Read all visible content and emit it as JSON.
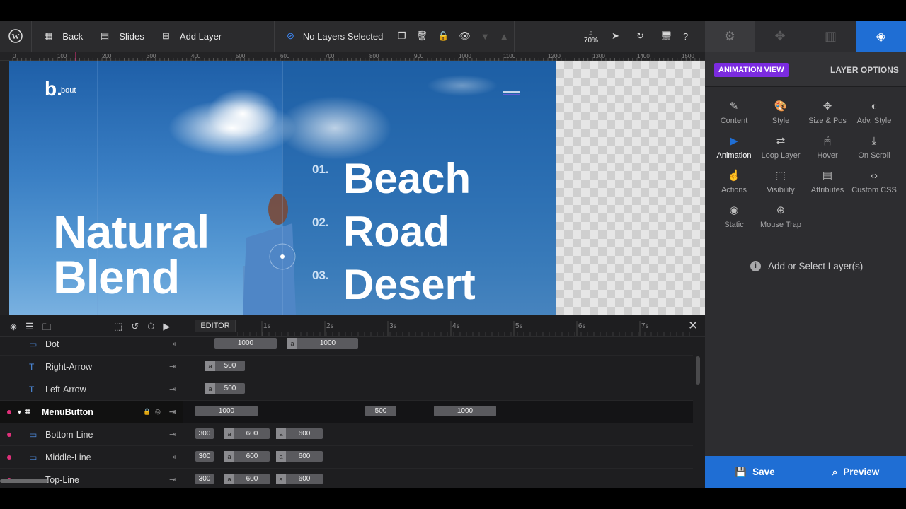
{
  "topbar": {
    "back": "Back",
    "slides": "Slides",
    "add_layer": "Add Layer",
    "status": "No Layers Selected",
    "zoom": "70%"
  },
  "ruler": {
    "marks": [
      "0",
      "100",
      "200",
      "300",
      "400",
      "500",
      "600",
      "700",
      "800",
      "900",
      "1000",
      "1100",
      "1200",
      "1300",
      "1400",
      "1500"
    ]
  },
  "canvas": {
    "logo": "b.",
    "logo_small": "bout",
    "headline1": "Natural",
    "headline2": "Blend",
    "items": [
      {
        "num": "01.",
        "label": "Beach"
      },
      {
        "num": "02.",
        "label": "Road"
      },
      {
        "num": "03.",
        "label": "Desert"
      }
    ]
  },
  "right_panel": {
    "tab_animation_view": "ANIMATION VIEW",
    "layer_options": "LAYER OPTIONS",
    "options": [
      {
        "icon": "pencil-icon",
        "label": "Content"
      },
      {
        "icon": "palette-icon",
        "label": "Style"
      },
      {
        "icon": "move-icon",
        "label": "Size & Pos"
      },
      {
        "icon": "contrast-icon",
        "label": "Adv. Style"
      },
      {
        "icon": "play-icon",
        "label": "Animation"
      },
      {
        "icon": "loop-icon",
        "label": "Loop Layer"
      },
      {
        "icon": "mouse-icon",
        "label": "Hover"
      },
      {
        "icon": "scroll-icon",
        "label": "On Scroll"
      },
      {
        "icon": "hand-icon",
        "label": "Actions"
      },
      {
        "icon": "visibility-icon",
        "label": "Visibility"
      },
      {
        "icon": "file-icon",
        "label": "Attributes"
      },
      {
        "icon": "code-icon",
        "label": "Custom CSS"
      },
      {
        "icon": "static-icon",
        "label": "Static"
      },
      {
        "icon": "target-icon",
        "label": "Mouse Trap"
      }
    ],
    "hint": "Add or Select Layer(s)",
    "save": "Save",
    "preview": "Preview"
  },
  "timeline": {
    "editor": "EDITOR",
    "ticks": [
      "1s",
      "2s",
      "3s",
      "4s",
      "5s",
      "6s",
      "7s"
    ],
    "layers": [
      {
        "name": "Dot",
        "type": "shape",
        "bars": [
          {
            "v": "1000"
          },
          {
            "a": "a",
            "v": "1000"
          }
        ]
      },
      {
        "name": "Right-Arrow",
        "type": "text",
        "bars": [
          {
            "a": "a",
            "v": "500"
          }
        ]
      },
      {
        "name": "Left-Arrow",
        "type": "text",
        "bars": [
          {
            "a": "a",
            "v": "500"
          }
        ]
      },
      {
        "name": "MenuButton",
        "type": "group",
        "bars": [
          {
            "v": "1000"
          },
          {
            "v": "500"
          },
          {
            "v": "1000"
          }
        ]
      },
      {
        "name": "Bottom-Line",
        "type": "shape",
        "bars": [
          {
            "v": "300"
          },
          {
            "a": "a",
            "v": "600"
          },
          {
            "a": "a",
            "v": "600"
          }
        ]
      },
      {
        "name": "Middle-Line",
        "type": "shape",
        "bars": [
          {
            "v": "300"
          },
          {
            "a": "a",
            "v": "600"
          },
          {
            "a": "a",
            "v": "600"
          }
        ]
      },
      {
        "name": "Top-Line",
        "type": "shape",
        "bars": [
          {
            "v": "300"
          },
          {
            "a": "a",
            "v": "600"
          },
          {
            "a": "a",
            "v": "600"
          }
        ]
      }
    ]
  },
  "colors": {
    "accent": "#1f6ed4",
    "purple": "#7b2be0",
    "pink": "#e0307a"
  }
}
